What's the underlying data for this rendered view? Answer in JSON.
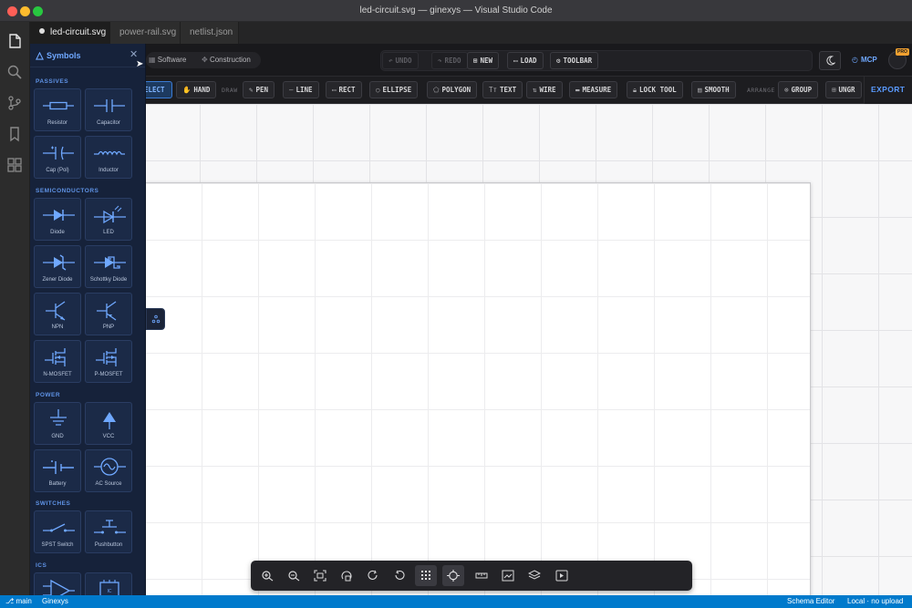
{
  "window": {
    "title": "led-circuit.svg — ginexys — Visual Studio Code"
  },
  "tabs": [
    {
      "label": "led-circuit.svg"
    },
    {
      "label": "power-rail.svg"
    },
    {
      "label": "netlist.json"
    }
  ],
  "topbar": {
    "pill_software": "Software",
    "pill_construction": "Construction",
    "undo": "UNDO",
    "redo": "REDO",
    "new": "NEW",
    "load": "LOAD",
    "toolbar": "TOOLBAR",
    "mcp": "MCP",
    "pro": "PRO"
  },
  "drawbar": {
    "select": "ELECT",
    "hand": "HAND",
    "group_draw": "DRAW",
    "pen": "PEN",
    "line": "LINE",
    "rect": "RECT",
    "ellipse": "ELLIPSE",
    "polygon": "POLYGON",
    "text": "TEXT",
    "wire": "WIRE",
    "measure": "MEASURE",
    "lock_tool": "LOCK TOOL",
    "smooth": "SMOOTH",
    "group_arrange": "ARRANGE",
    "group": "GROUP",
    "ungroup": "UNGR",
    "export": "EXPORT"
  },
  "sidebar": {
    "title": "Symbols",
    "sections": {
      "passives": "PASSIVES",
      "semiconductors": "SEMICONDUCTORS",
      "power": "POWER",
      "switches": "SWITCHES",
      "ics": "ICS"
    },
    "items": {
      "resistor": "Resistor",
      "capacitor": "Capacitor",
      "cap_pol": "Cap (Pol)",
      "inductor": "Inductor",
      "diode": "Diode",
      "led": "LED",
      "zener": "Zener Diode",
      "schottky": "Schottky Diode",
      "npn": "NPN",
      "pnp": "PNP",
      "nmosfet": "N-MOSFET",
      "pmosfet": "P-MOSFET",
      "gnd": "GND",
      "vcc": "VCC",
      "battery": "Battery",
      "ac_source": "AC Source",
      "spst": "SPST Switch",
      "pushbutton": "Pushbutton",
      "ic_label": "IC"
    }
  },
  "statusbar": {
    "branch": "main",
    "project": "Ginexys",
    "mode": "Schema Editor",
    "upload": "Local · no upload"
  },
  "colors": {
    "accent": "#6fa8ff",
    "status": "#007acc",
    "sidebar": "#16223a"
  }
}
